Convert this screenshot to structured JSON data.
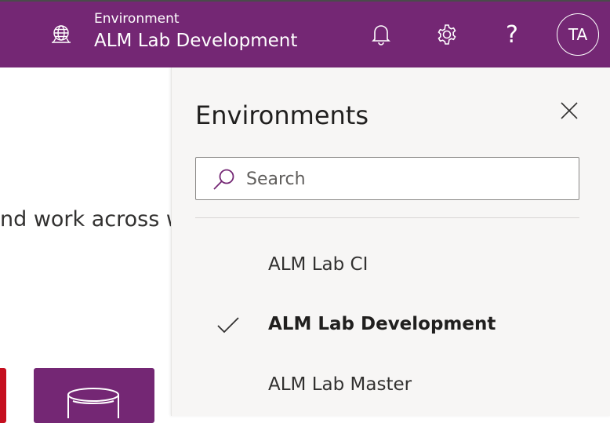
{
  "header": {
    "env_label": "Environment",
    "env_name": "ALM Lab Development",
    "avatar_initials": "TA",
    "help_symbol": "?",
    "brand_color": "#742774"
  },
  "background": {
    "text_fragment": "nd work across w"
  },
  "panel": {
    "title": "Environments",
    "search": {
      "placeholder": "Search",
      "value": ""
    },
    "environments": [
      {
        "label": "ALM Lab CI",
        "selected": false
      },
      {
        "label": "ALM Lab Development",
        "selected": true
      },
      {
        "label": "ALM Lab Master",
        "selected": false
      }
    ]
  },
  "icons": {
    "environment": "globe-environment-icon",
    "notifications": "bell-icon",
    "settings": "gear-icon",
    "help": "question-mark-icon",
    "close": "close-icon",
    "search": "search-icon",
    "checkmark": "checkmark-icon",
    "database": "database-icon"
  }
}
